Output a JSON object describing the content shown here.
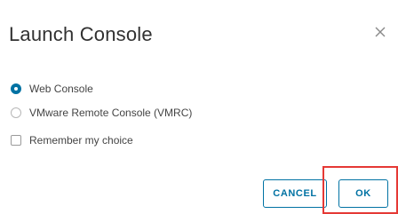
{
  "dialog": {
    "title": "Launch Console",
    "close_icon": "close-icon"
  },
  "options": {
    "web_console": {
      "label": "Web Console",
      "selected": true
    },
    "vmrc": {
      "label": "VMware Remote Console (VMRC)",
      "selected": false
    }
  },
  "remember": {
    "label": "Remember my choice",
    "checked": false
  },
  "buttons": {
    "cancel_label": "CANCEL",
    "ok_label": "OK"
  },
  "colors": {
    "accent": "#0072a3",
    "highlight": "#e53935"
  }
}
